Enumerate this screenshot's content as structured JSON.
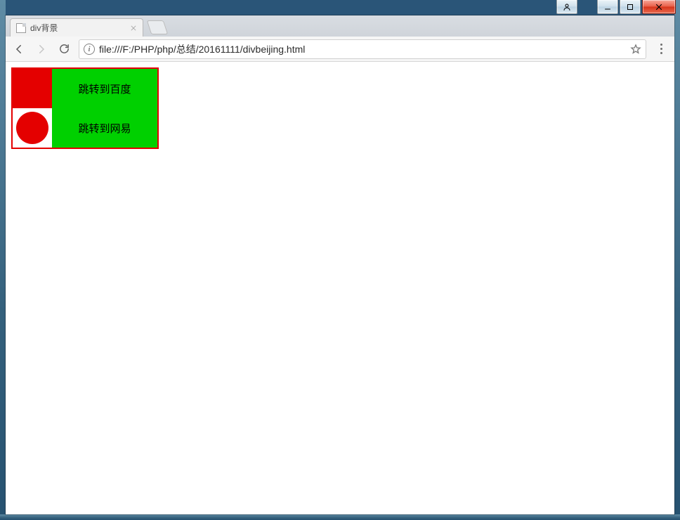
{
  "window": {
    "buttons": {
      "user": "user-icon",
      "minimize": "minimize-icon",
      "maximize": "maximize-icon",
      "close": "close-icon"
    }
  },
  "browser": {
    "tab": {
      "title": "div背景",
      "icon": "page-icon",
      "close": "close-icon"
    },
    "nav": {
      "back": "back-icon",
      "forward": "forward-icon",
      "reload": "reload-icon"
    },
    "omnibox": {
      "info": "info-icon",
      "url": "file:///F:/PHP/php/总结/20161111/divbeijing.html",
      "star": "star-icon"
    },
    "menu": "menu-icon"
  },
  "page": {
    "links": {
      "baidu": "跳转到百度",
      "netease": "跳转到网易"
    },
    "colors": {
      "border": "#e40000",
      "square": "#e40000",
      "circle": "#e40000",
      "panel": "#00d000"
    }
  }
}
